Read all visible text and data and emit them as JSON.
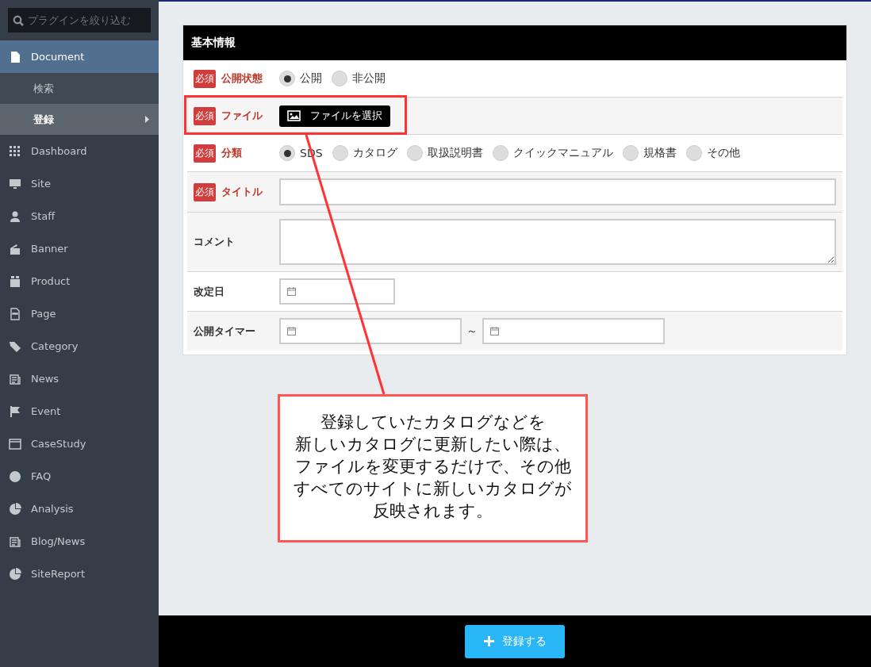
{
  "sidebar": {
    "search": {
      "placeholder": "プラグインを絞り込む"
    },
    "items": [
      {
        "label": "Document",
        "selected": true,
        "children": [
          {
            "label": "検索",
            "selected": false
          },
          {
            "label": "登録",
            "selected": true
          }
        ]
      },
      {
        "label": "Dashboard",
        "selected": false
      },
      {
        "label": "Site",
        "selected": false
      },
      {
        "label": "Staff",
        "selected": false
      },
      {
        "label": "Banner",
        "selected": false
      },
      {
        "label": "Product",
        "selected": false
      },
      {
        "label": "Page",
        "selected": false
      },
      {
        "label": "Category",
        "selected": false
      },
      {
        "label": "News",
        "selected": false
      },
      {
        "label": "Event",
        "selected": false
      },
      {
        "label": "CaseStudy",
        "selected": false
      },
      {
        "label": "FAQ",
        "selected": false
      },
      {
        "label": "Analysis",
        "selected": false
      },
      {
        "label": "Blog/News",
        "selected": false
      },
      {
        "label": "SiteReport",
        "selected": false
      }
    ]
  },
  "form": {
    "title": "基本情報",
    "rows": [
      {
        "kind": "radio",
        "badge": "必須",
        "label": "公開状態",
        "options": [
          {
            "label": "公開",
            "selected": true
          },
          {
            "label": "非公開",
            "selected": false
          }
        ]
      },
      {
        "kind": "file",
        "badge": "必須",
        "label": "ファイル",
        "button": "ファイルを選択"
      },
      {
        "kind": "radio",
        "badge": "必須",
        "label": "分類",
        "options": [
          {
            "label": "SDS",
            "selected": true
          },
          {
            "label": "カタログ",
            "selected": false
          },
          {
            "label": "取扱説明書",
            "selected": false
          },
          {
            "label": "クイックマニュアル",
            "selected": false
          },
          {
            "label": "規格書",
            "selected": false
          },
          {
            "label": "その他",
            "selected": false
          }
        ]
      },
      {
        "kind": "text",
        "badge": "必須",
        "label": "タイトル"
      },
      {
        "kind": "textarea",
        "label": "コメント"
      },
      {
        "kind": "date",
        "label": "改定日"
      },
      {
        "kind": "date_range",
        "label": "公開タイマー",
        "separator": "～"
      }
    ]
  },
  "callout": {
    "lines": [
      "登録していたカタログなどを",
      "新しいカタログに更新したい際は、ファイルを変更するだけで、その他すべてのサイトに新しいカタログが反映されます。"
    ]
  },
  "footer": {
    "submit": "登録する"
  }
}
